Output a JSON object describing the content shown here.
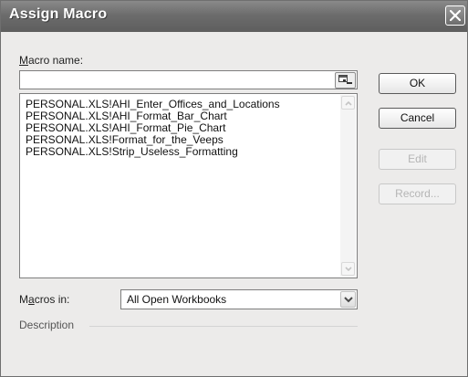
{
  "window": {
    "title": "Assign Macro"
  },
  "macro_name": {
    "label_hotkey": "M",
    "label_rest": "acro name:",
    "value": ""
  },
  "macros": [
    "PERSONAL.XLS!AHI_Enter_Offices_and_Locations",
    "PERSONAL.XLS!AHI_Format_Bar_Chart",
    "PERSONAL.XLS!AHI_Format_Pie_Chart",
    "PERSONAL.XLS!Format_for_the_Veeps",
    "PERSONAL.XLS!Strip_Useless_Formatting"
  ],
  "buttons": {
    "ok": "OK",
    "cancel": "Cancel",
    "edit": "Edit",
    "record": "Record..."
  },
  "macros_in": {
    "label_pre": "M",
    "label_hotkey": "a",
    "label_rest": "cros in:",
    "selected": "All Open Workbooks"
  },
  "description": {
    "label": "Description"
  },
  "icons": {
    "close": "close-icon",
    "collapse": "collapse-dialog-icon",
    "dropdown": "chevron-down-icon"
  },
  "colors": {
    "titlebar": "#6c6c6c",
    "dialog_bg": "#ecebea"
  }
}
